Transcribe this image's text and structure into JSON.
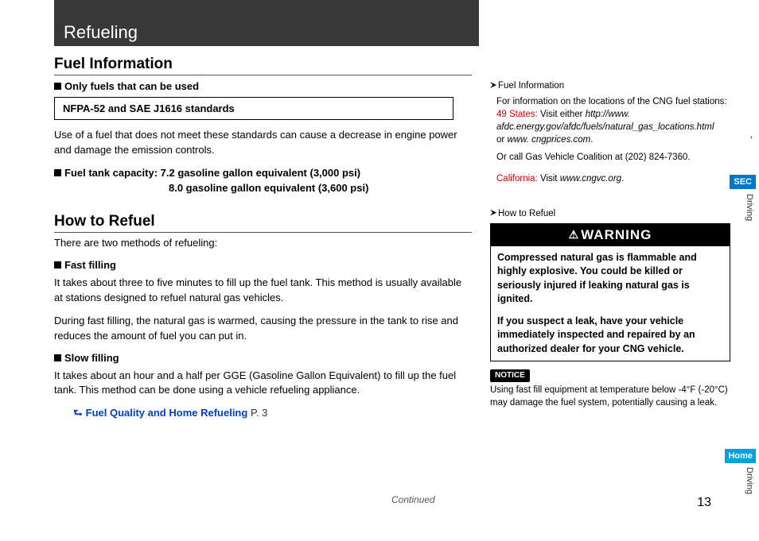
{
  "banner": {
    "title": "Refueling"
  },
  "fuel_info": {
    "heading": "Fuel Information",
    "only_fuels_label": "Only fuels that can be used",
    "standards": "NFPA-52 and SAE J1616 standards",
    "nonconforming_text": "Use of a fuel that does not meet these standards can cause a decrease in engine power and damage the emission controls.",
    "capacity_label": "Fuel tank capacity:",
    "capacity_line1": "7.2 gasoline gallon equivalent (3,000 psi)",
    "capacity_line2": "8.0 gasoline gallon equivalent (3,600 psi)"
  },
  "how_to_refuel": {
    "heading": "How to Refuel",
    "intro": "There are two methods of refueling:",
    "fast_label": "Fast filling",
    "fast_p1": "It takes about three to five minutes to fill up the fuel tank. This method is usually available at stations designed to refuel natural gas vehicles.",
    "fast_p2": "During fast filling, the natural gas is warmed, causing the pressure in the tank to rise and reduces the amount of fuel you can put in.",
    "slow_label": "Slow filling",
    "slow_p1": "It takes about an hour and a half per GGE (Gasoline Gallon Equivalent) to fill up the fuel tank. This method can be done using a vehicle refueling appliance.",
    "crossref_label": "Fuel Quality and Home Refueling",
    "crossref_page": "P. 3"
  },
  "side": {
    "fuel_info_head": "Fuel Information",
    "locations_intro": "For information on the locations of the CNG fuel stations:",
    "states_label": "49 States:",
    "states_text": "Visit either",
    "url1": "http://www. afdc.energy.gov/afdc/fuels/natural_gas_locations.html",
    "or": "or",
    "url2": "www. cngprices.com",
    "call_text": "Or call Gas Vehicle Coalition at (202) 824-7360.",
    "california_label": "California:",
    "california_text": "Visit",
    "california_url": "www.cngvc.org",
    "how_head": "How to Refuel",
    "warning_title": "WARNING",
    "warning_body1": "Compressed natural gas is flammable and highly explosive. You could be killed or seriously injured if leaking natural gas is ignited.",
    "warning_body2": "If you suspect a leak, have your vehicle immediately inspected and repaired by an authorized dealer for your CNG vehicle.",
    "notice_label": "NOTICE",
    "notice_text": "Using fast fill equipment at temperature below -4°F (-20°C) may damage the fuel system, potentially causing a leak."
  },
  "footer": {
    "continued": "Continued",
    "page": "13"
  },
  "tabs": {
    "sec": "SEC",
    "driving": "Driving",
    "home": "Home",
    "driving2": "Driving"
  },
  "stray": ","
}
